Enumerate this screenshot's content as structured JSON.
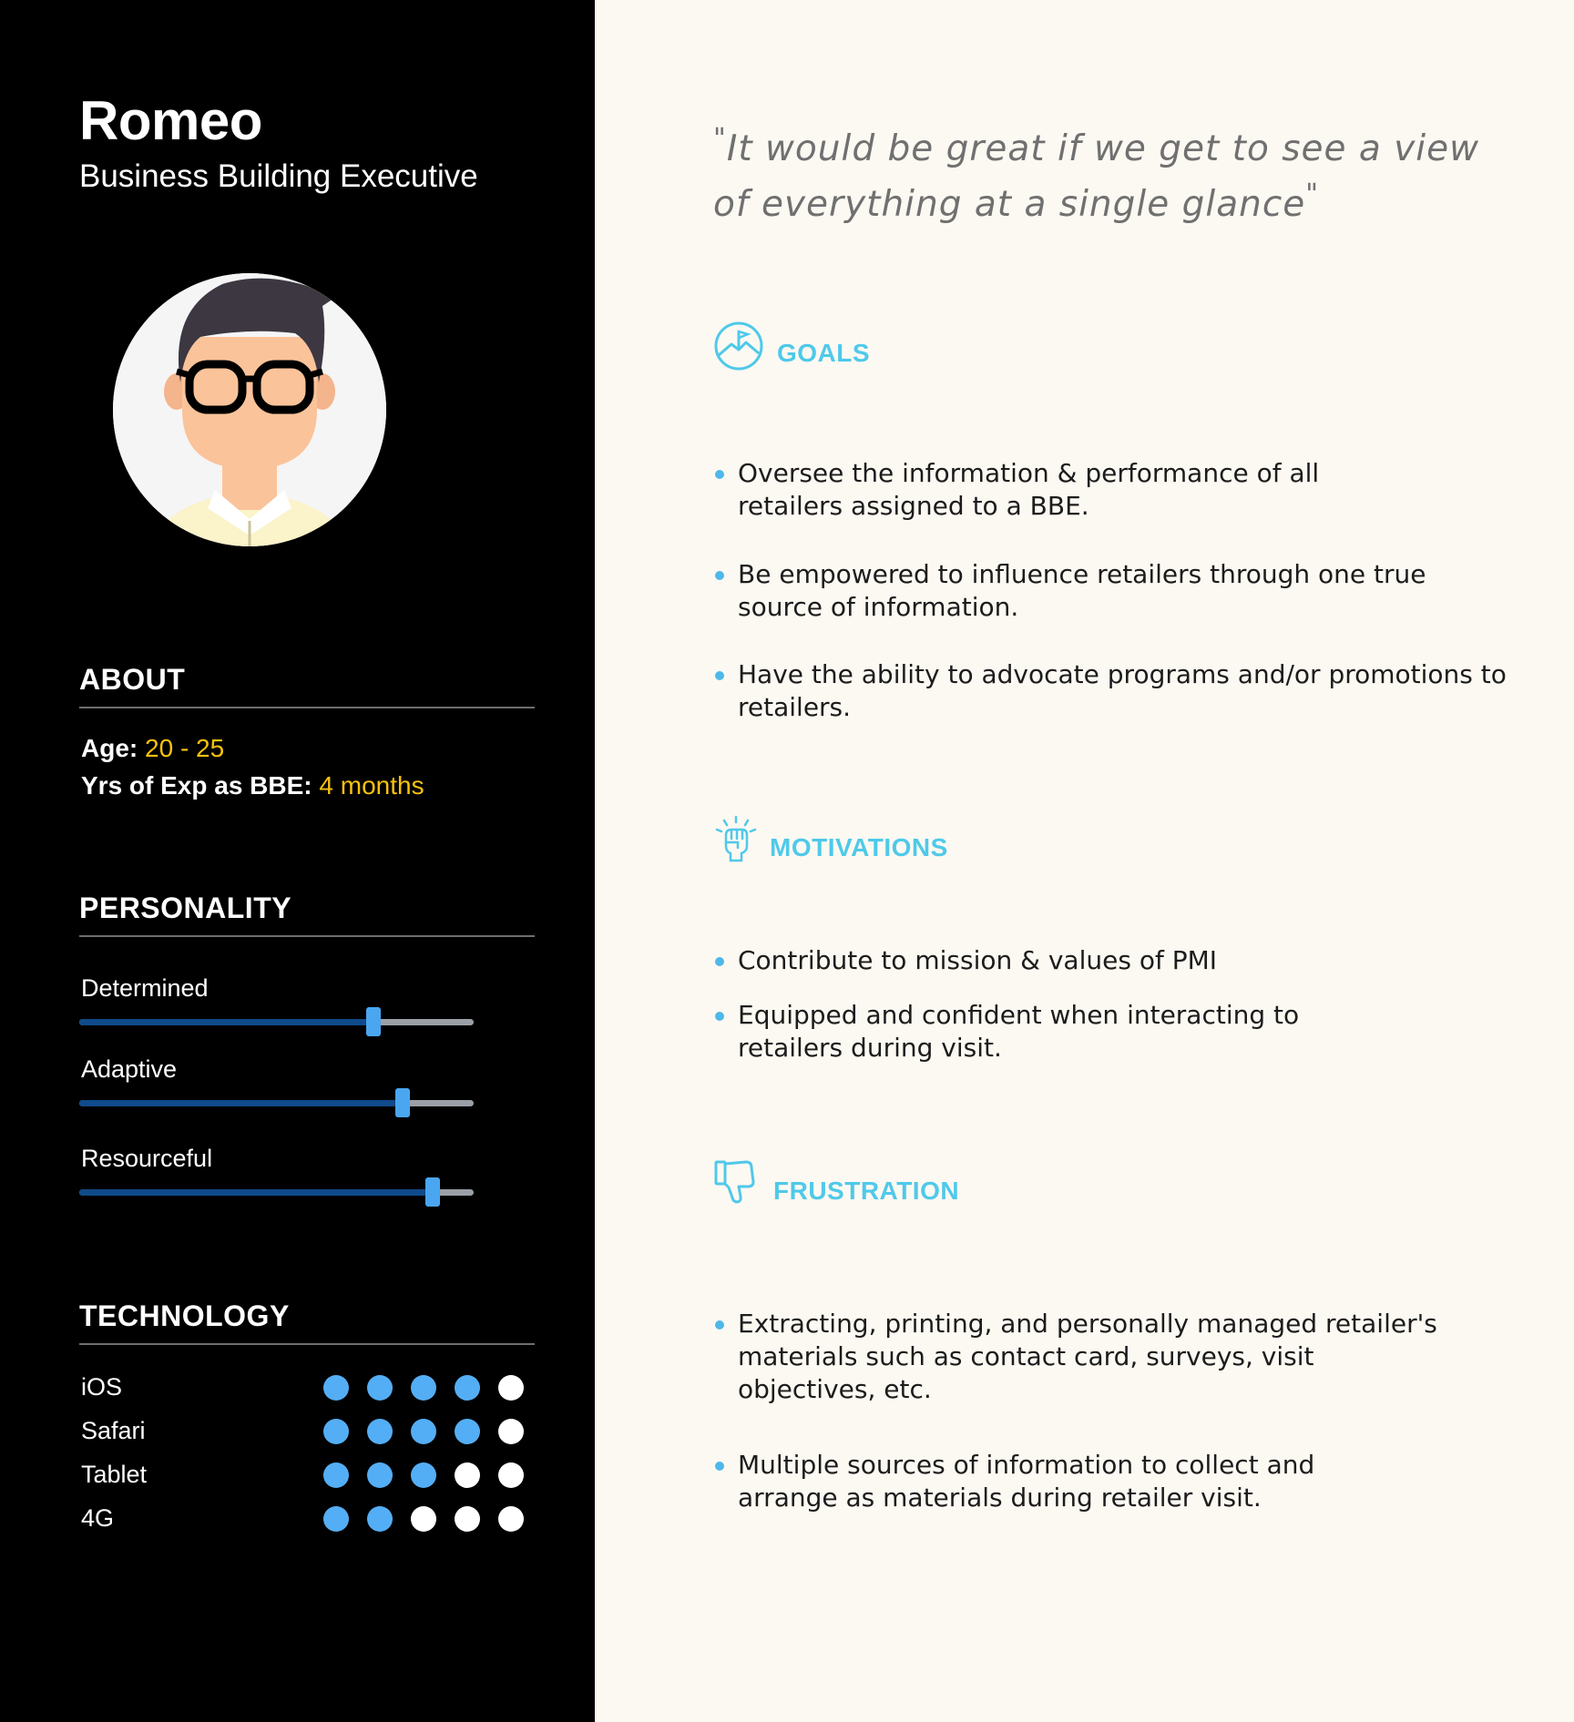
{
  "persona": {
    "name": "Romeo",
    "role": "Business Building Executive",
    "avatar_icon": "man-with-glasses-avatar"
  },
  "about": {
    "title": "ABOUT",
    "age_label": "Age:",
    "age_value": "20 - 25",
    "exp_label": "Yrs of Exp as BBE:",
    "exp_value": "4 months"
  },
  "personality": {
    "title": "PERSONALITY",
    "traits": [
      {
        "label": "Determined",
        "level": 0.745
      },
      {
        "label": "Adaptive",
        "level": 0.82
      },
      {
        "label": "Resourceful",
        "level": 0.897
      }
    ]
  },
  "technology": {
    "title": "TECHNOLOGY",
    "max": 5,
    "items": [
      {
        "label": "iOS",
        "rating": 4
      },
      {
        "label": "Safari",
        "rating": 4
      },
      {
        "label": "Tablet",
        "rating": 3
      },
      {
        "label": "4G",
        "rating": 2
      }
    ]
  },
  "quote": {
    "open": "\"",
    "text": "It would be great if we get to see a view of everything at a single glance",
    "close": "\""
  },
  "goals": {
    "title": "GOALS",
    "icon": "mountain-flag-icon",
    "items": [
      "Oversee the information & performance of all retailers assigned to a BBE.",
      "Be empowered to influence retailers through one true source of information.",
      "Have the ability to advocate programs and/or promotions to retailers."
    ]
  },
  "motivations": {
    "title": "MOTIVATIONS",
    "icon": "raised-fist-icon",
    "items": [
      "Contribute to mission & values of PMI",
      "Equipped and confident when interacting to retailers during visit."
    ]
  },
  "frustration": {
    "title": "FRUSTRATION",
    "icon": "thumbs-down-icon",
    "items": [
      "Extracting, printing, and personally managed retailer's materials such as contact card,  surveys, visit objectives, etc.",
      "Multiple sources of information to collect and arrange as materials during retailer visit."
    ]
  },
  "colors": {
    "accent_cyan": "#4fc9ea",
    "highlight_yellow": "#f7c20d",
    "slider_fill": "#0f4a8a",
    "slider_thumb": "#4aa6f0",
    "dot_on": "#54aef5",
    "dot_off": "#ffffff"
  }
}
